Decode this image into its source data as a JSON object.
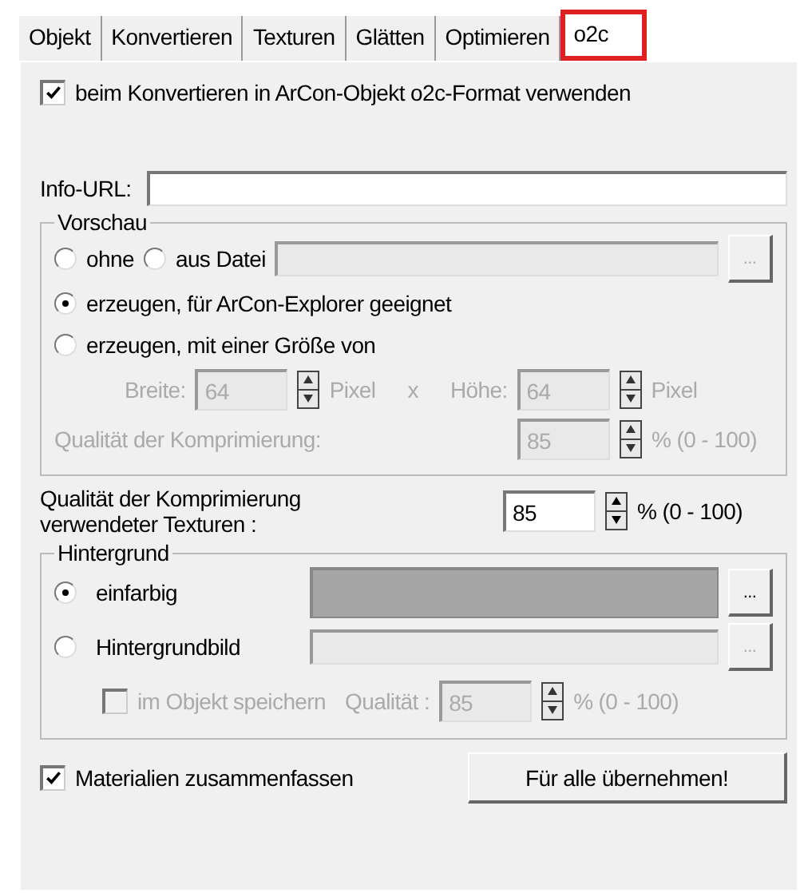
{
  "tabs": [
    {
      "label": "Objekt",
      "selected": false,
      "highlighted": false
    },
    {
      "label": "Konvertieren",
      "selected": false,
      "highlighted": false
    },
    {
      "label": "Texturen",
      "selected": false,
      "highlighted": false
    },
    {
      "label": "Glätten",
      "selected": false,
      "highlighted": false
    },
    {
      "label": "Optimieren",
      "selected": false,
      "highlighted": false
    },
    {
      "label": "o2c",
      "selected": true,
      "highlighted": true
    }
  ],
  "use_o2c": {
    "label": "beim Konvertieren in ArCon-Objekt o2c-Format verwenden",
    "checked": true
  },
  "info_url": {
    "label": "Info-URL:"
  },
  "preview": {
    "title": "Vorschau",
    "options": [
      {
        "label": "ohne",
        "selected": false
      },
      {
        "label": "aus Datei",
        "selected": false
      },
      {
        "label": "erzeugen, für ArCon-Explorer geeignet",
        "selected": true
      },
      {
        "label": "erzeugen, mit einer Größe von",
        "selected": false
      }
    ],
    "file_disabled": true,
    "browse_button": "...",
    "size_disabled": true,
    "width": {
      "label": "Breite:",
      "value": "64",
      "unit": "Pixel"
    },
    "times": "x",
    "height": {
      "label": "Höhe:",
      "value": "64",
      "unit": "Pixel"
    },
    "quality": {
      "label": "Qualität der Komprimierung:",
      "value": "85",
      "range": "% (0 - 100)"
    }
  },
  "texture_quality": {
    "label": "Qualität der Komprimierung\nverwendeter Texturen :",
    "value": "85",
    "range": "% (0 - 100)"
  },
  "background": {
    "title": "Hintergrund",
    "options": [
      {
        "label": "einfarbig",
        "selected": true,
        "kind": "color",
        "color": "#a6a6a6",
        "button": "...",
        "disabled": false
      },
      {
        "label": "Hintergrundbild",
        "selected": false,
        "kind": "image",
        "button": "...",
        "disabled": true
      }
    ],
    "save_in_object": {
      "label": "im Objekt speichern",
      "checked": false,
      "disabled": true
    },
    "quality": {
      "label": "Qualität :",
      "value": "85",
      "range": "% (0 - 100)",
      "disabled": true
    }
  },
  "merge_materials": {
    "label": "Materialien zusammenfassen",
    "checked": true
  },
  "apply_all_button": "Für alle übernehmen!"
}
